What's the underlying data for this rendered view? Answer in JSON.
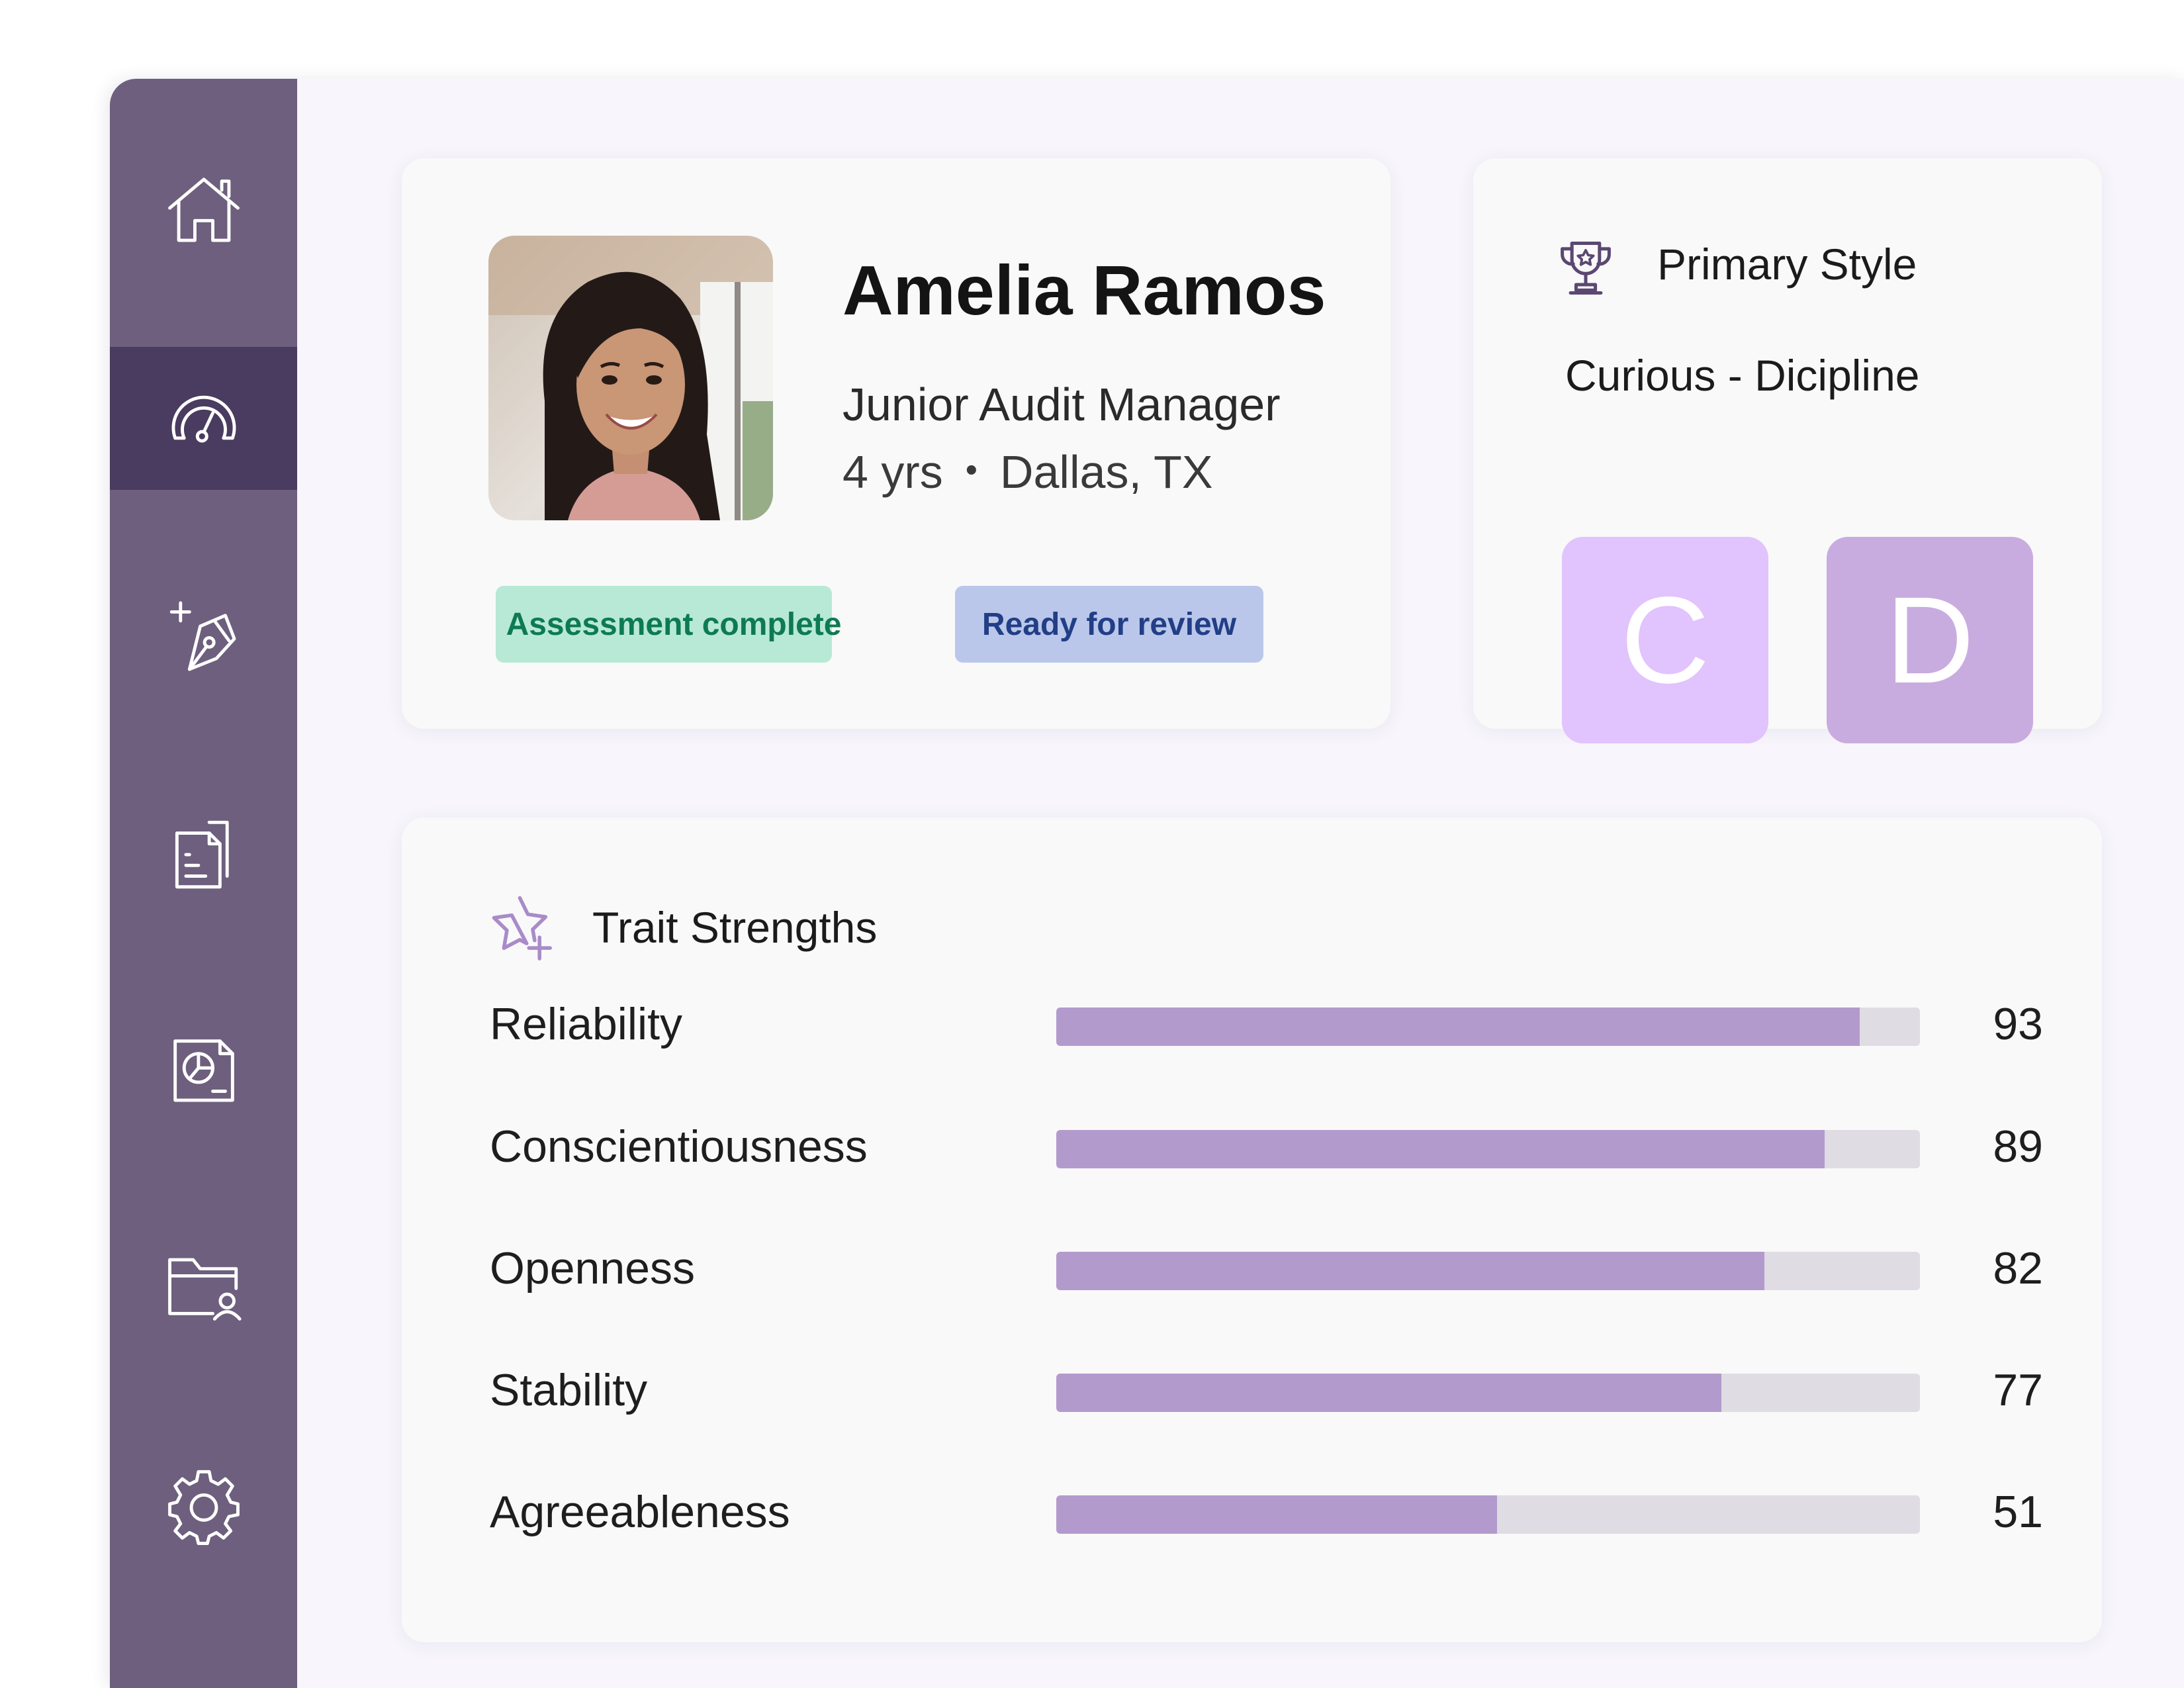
{
  "nav": {
    "items": [
      {
        "icon": "home-icon",
        "active": false
      },
      {
        "icon": "dashboard-gauge-icon",
        "active": true
      },
      {
        "icon": "pen-add-icon",
        "active": false
      },
      {
        "icon": "documents-icon",
        "active": false
      },
      {
        "icon": "report-chart-icon",
        "active": false
      },
      {
        "icon": "folder-user-icon",
        "active": false
      },
      {
        "icon": "settings-gear-icon",
        "active": false
      }
    ]
  },
  "profile": {
    "name": "Amelia Ramos",
    "role": "Junior Audit Manager",
    "tenure": "4 yrs",
    "location": "Dallas, TX",
    "badges": {
      "complete": "Assessment complete",
      "review": "Ready for review"
    }
  },
  "primary_style": {
    "title": "Primary Style",
    "value": "Curious - Dicipline",
    "letters": [
      "C",
      "D"
    ]
  },
  "traits": {
    "title": "Trait Strengths",
    "items": [
      {
        "label": "Reliability",
        "value": 93
      },
      {
        "label": "Conscientiousness",
        "value": 89
      },
      {
        "label": "Openness",
        "value": 82
      },
      {
        "label": "Stability",
        "value": 77
      },
      {
        "label": "Agreeableness",
        "value": 51
      }
    ]
  },
  "colors": {
    "sidebar": "#6d5f7d",
    "sidebar_active": "#4a3b60",
    "bar_fill": "#b39acd",
    "bar_track": "#dfdce4",
    "badge_complete_bg": "#b7e9d6",
    "badge_complete_text": "#0e7a52",
    "badge_review_bg": "#bac7ea",
    "badge_review_text": "#213e86",
    "tile_c": "#e1c3fd",
    "tile_d": "#c9acdf"
  }
}
